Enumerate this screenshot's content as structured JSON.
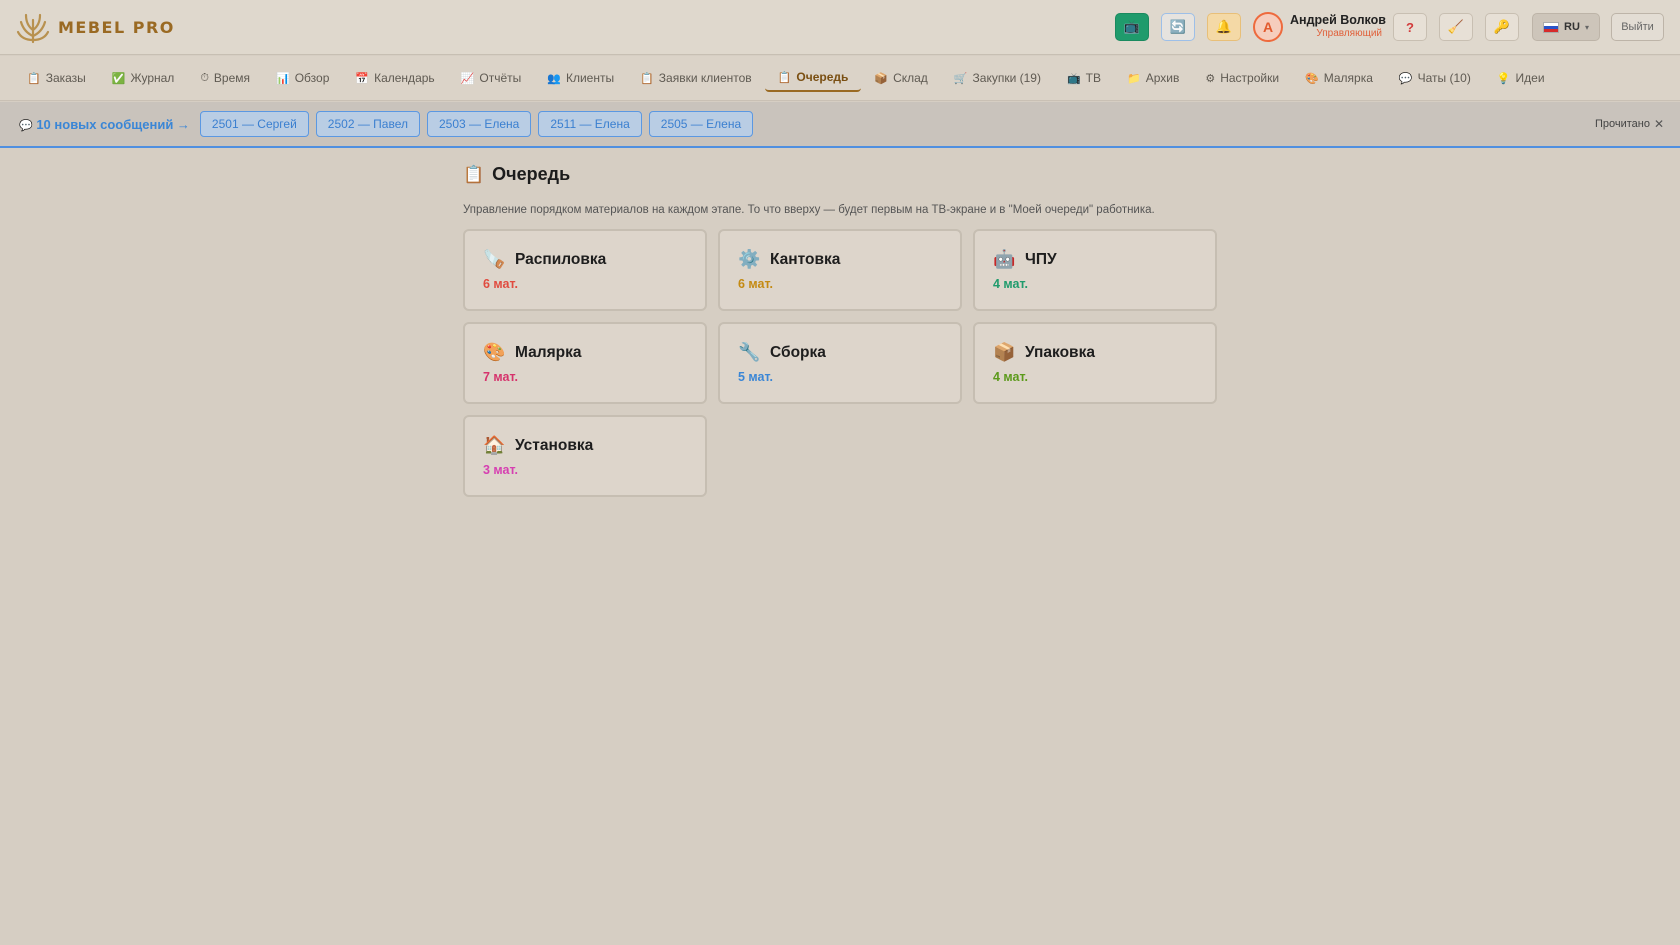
{
  "brand": {
    "name": "MEBEL PRO"
  },
  "header": {
    "buttons": [
      {
        "name": "monitor-button",
        "icon": "📺"
      },
      {
        "name": "refresh-button",
        "icon": "🔄"
      },
      {
        "name": "notifications-button",
        "icon": "🔔"
      }
    ],
    "avatar_letter": "А",
    "user_name": "Андрей Волков",
    "user_role": "Управляющий",
    "help_icon": "?",
    "tool1_icon": "🧹",
    "tool2_icon": "🔑",
    "lang": "RU",
    "logout": "Выйти"
  },
  "nav": [
    {
      "id": "orders",
      "icon": "📋",
      "label": "Заказы"
    },
    {
      "id": "journal",
      "icon": "✅",
      "label": "Журнал"
    },
    {
      "id": "time",
      "icon": "⏱",
      "label": "Время"
    },
    {
      "id": "overview",
      "icon": "📊",
      "label": "Обзор"
    },
    {
      "id": "calendar",
      "icon": "📅",
      "label": "Календарь"
    },
    {
      "id": "reports",
      "icon": "📈",
      "label": "Отчёты"
    },
    {
      "id": "clients",
      "icon": "👥",
      "label": "Клиенты"
    },
    {
      "id": "client-requests",
      "icon": "📋",
      "label": "Заявки клиентов"
    },
    {
      "id": "queue",
      "icon": "📋",
      "label": "Очередь",
      "active": true
    },
    {
      "id": "warehouse",
      "icon": "📦",
      "label": "Склад"
    },
    {
      "id": "purchases",
      "icon": "🛒",
      "label": "Закупки (19)"
    },
    {
      "id": "tv",
      "icon": "📺",
      "label": "ТВ"
    },
    {
      "id": "archive",
      "icon": "📁",
      "label": "Архив"
    },
    {
      "id": "settings",
      "icon": "⚙",
      "label": "Настройки"
    },
    {
      "id": "painting",
      "icon": "🎨",
      "label": "Малярка"
    },
    {
      "id": "chats",
      "icon": "💬",
      "label": "Чаты (10)"
    },
    {
      "id": "ideas",
      "icon": "💡",
      "label": "Идеи"
    }
  ],
  "messages": {
    "icon": "💬",
    "summary": "10 новых сообщений →",
    "chips": [
      "2501 — Сергей",
      "2502 — Павел",
      "2503 — Елена",
      "2511 — Елена",
      "2505 — Елена"
    ],
    "read_all": "Прочитано",
    "close_icon": "✕"
  },
  "page": {
    "icon": "📋",
    "title": "Очередь",
    "description": "Управление порядком материалов на каждом этапе. То что вверху — будет первым на ТВ-экране и в \"Моей очереди\" работника."
  },
  "stages": [
    {
      "id": "cutting",
      "icon": "🪚",
      "title": "Распиловка",
      "count": "6 мат.",
      "color": "#e04b3f"
    },
    {
      "id": "edging",
      "icon": "⚙️",
      "title": "Кантовка",
      "count": "6 мат.",
      "color": "#c48a12"
    },
    {
      "id": "cnc",
      "icon": "🤖",
      "title": "ЧПУ",
      "count": "4 мат.",
      "color": "#1f9b6c"
    },
    {
      "id": "painting",
      "icon": "🎨",
      "title": "Малярка",
      "count": "7 мат.",
      "color": "#d6336c"
    },
    {
      "id": "assembly",
      "icon": "🔧",
      "title": "Сборка",
      "count": "5 мат.",
      "color": "#3a86d6"
    },
    {
      "id": "packing",
      "icon": "📦",
      "title": "Упаковка",
      "count": "4 мат.",
      "color": "#5c9a1b"
    },
    {
      "id": "install",
      "icon": "🏠",
      "title": "Установка",
      "count": "3 мат.",
      "color": "#d63fb1"
    }
  ]
}
